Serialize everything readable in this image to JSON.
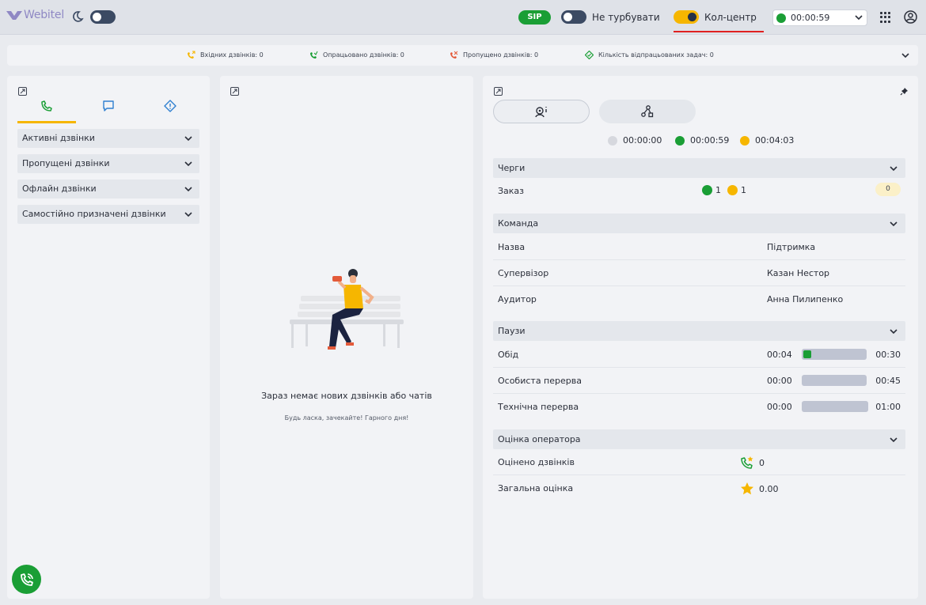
{
  "header": {
    "logo_text": "Webitel",
    "sip_label": "SIP",
    "dnd_label": "Не турбувати",
    "callcenter_label": "Кол-центр",
    "status_time": "00:00:59"
  },
  "stats": {
    "incoming": "Вхідних дзвінків: 0",
    "processed": "Опрацьовано дзвінків: 0",
    "missed": "Пропущено дзвінків: 0",
    "tasks": "Кількість відпрацьованих задач: 0"
  },
  "left": {
    "accordions": [
      "Активні дзвінки",
      "Пропущені дзвінки",
      "Офлайн дзвінки",
      "Самостійно призначені дзвінки"
    ]
  },
  "middle": {
    "empty_title": "Зараз немає нових дзвінків або чатів",
    "empty_subtitle": "Будь ласка, зачекайте! Гарного дня!"
  },
  "right": {
    "timers": {
      "grey": "00:00:00",
      "green": "00:00:59",
      "yellow": "00:04:03"
    },
    "queues": {
      "title": "Черги",
      "name": "Заказ",
      "green_count": "1",
      "yellow_count": "1",
      "badge": "0"
    },
    "team": {
      "title": "Команда",
      "rows": [
        {
          "k": "Назва",
          "v": "Підтримка"
        },
        {
          "k": "Супервізор",
          "v": "Казан Нестор"
        },
        {
          "k": "Аудитор",
          "v": "Анна Пилипенко"
        }
      ]
    },
    "pauses": {
      "title": "Паузи",
      "rows": [
        {
          "k": "Обід",
          "start": "00:04",
          "end": "00:30",
          "progress": 0.13
        },
        {
          "k": "Особиста перерва",
          "start": "00:00",
          "end": "00:45",
          "progress": 0
        },
        {
          "k": "Технічна перерва",
          "start": "00:00",
          "end": "01:00",
          "progress": 0
        }
      ]
    },
    "rating": {
      "title": "Оцінка оператора",
      "rated_label": "Оцінено дзвінків",
      "rated_value": "0",
      "total_label": "Загальна оцінка",
      "total_value": "0.00"
    }
  },
  "colors": {
    "green": "#1a9e35",
    "yellow": "#f6b600",
    "grey_dot": "#d6d8de",
    "red": "#e02020"
  }
}
